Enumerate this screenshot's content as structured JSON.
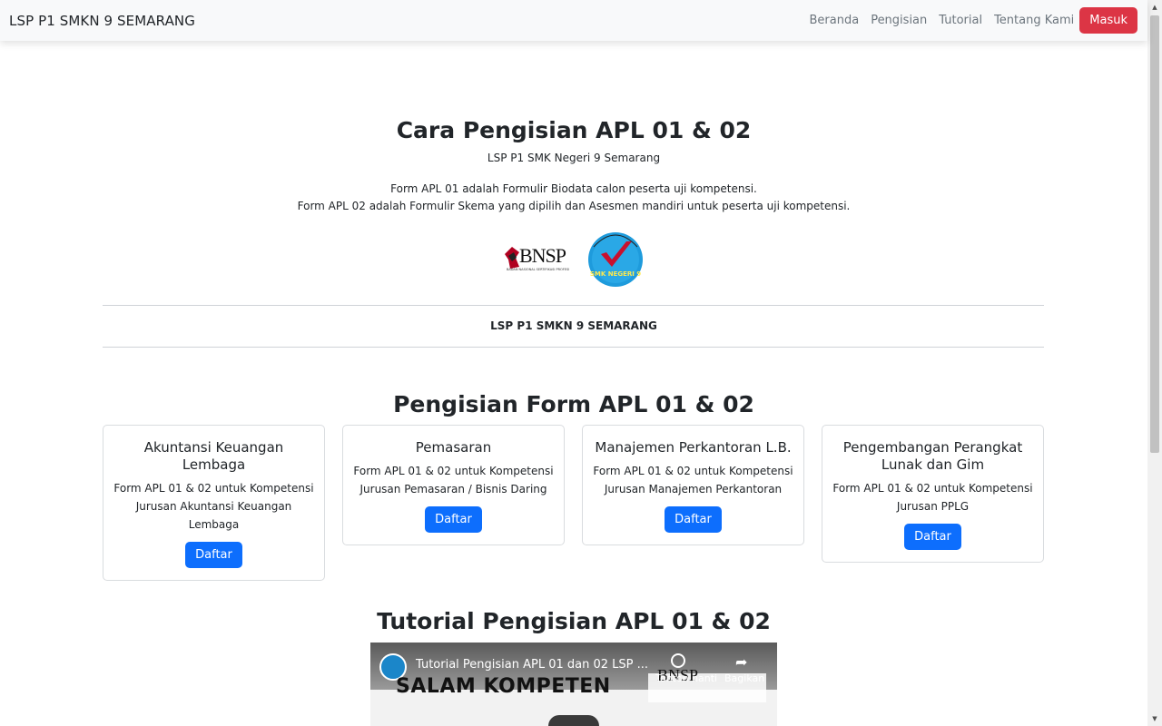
{
  "navbar": {
    "brand": "LSP P1 SMKN 9 SEMARANG",
    "links": [
      "Beranda",
      "Pengisian",
      "Tutorial",
      "Tentang Kami"
    ],
    "login_label": "Masuk"
  },
  "hero": {
    "title": "Cara Pengisian APL 01 & 02",
    "subtitle": "LSP P1 SMK Negeri 9 Semarang",
    "desc_line1": "Form APL 01 adalah Formulir Biodata calon peserta uji kompetensi.",
    "desc_line2": "Form APL 02 adalah Formulir Skema yang dipilih dan Asesmen mandiri untuk peserta uji kompetensi.",
    "bnsp_logo_text": "BNSP",
    "bnsp_logo_small": "BADAN NASIONAL SERTIFIKASI PROFESI",
    "smk_logo_text": "SMK NEGERI 9"
  },
  "org_name": "LSP P1 SMKN 9 SEMARANG",
  "forms": {
    "title": "Pengisian Form APL 01 & 02",
    "cards": [
      {
        "title": "Akuntansi Keuangan Lembaga",
        "text": "Form APL 01 & 02 untuk Kompetensi Jurusan Akuntansi Keuangan Lembaga",
        "button": "Daftar"
      },
      {
        "title": "Pemasaran",
        "text": "Form APL 01 & 02 untuk Kompetensi Jurusan Pemasaran / Bisnis Daring",
        "button": "Daftar"
      },
      {
        "title": "Manajemen Perkantoran L.B.",
        "text": "Form APL 01 & 02 untuk Kompetensi Jurusan Manajemen Perkantoran",
        "button": "Daftar"
      },
      {
        "title": "Pengembangan Perangkat Lunak dan Gim",
        "text": "Form APL 01 & 02 untuk Kompetensi Jurusan PPLG",
        "button": "Daftar"
      }
    ]
  },
  "tutorial": {
    "title": "Tutorial Pengisian APL 01 & 02",
    "video_title": "Tutorial Pengisian APL 01 dan 02 LSP ...",
    "video_banner": "SALAM KOMPETEN",
    "video_logo": "BNSP",
    "watch_later": "Tonton nanti",
    "share": "Bagikan"
  },
  "colors": {
    "primary": "#0d6efd",
    "danger": "#dc3545",
    "navbar_bg": "#f8f9fa"
  }
}
